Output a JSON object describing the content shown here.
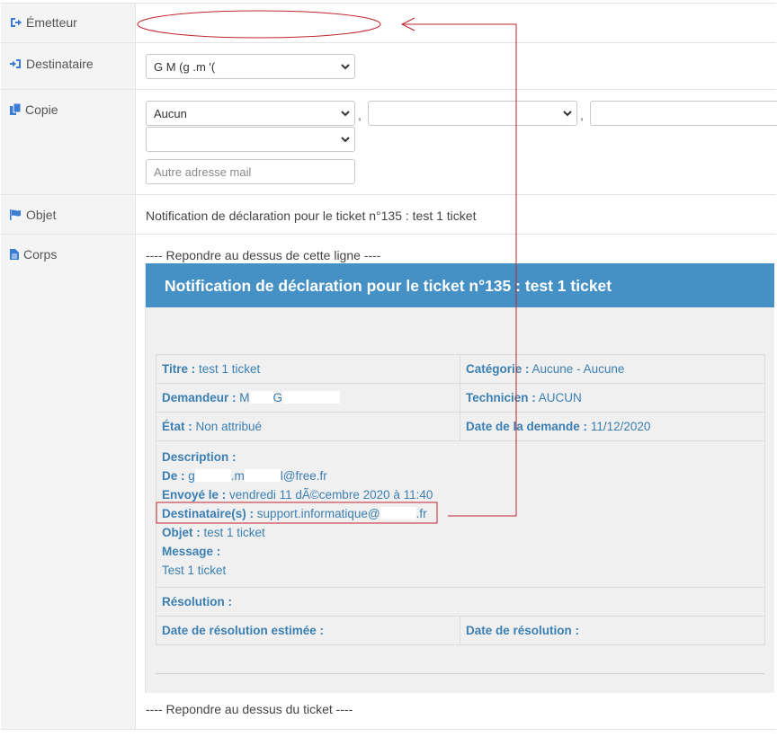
{
  "fields": {
    "emetteur": {
      "label": "Émetteur"
    },
    "destinataire": {
      "label": "Destinataire",
      "selected_value": "G          M      (g            .m          '("
    },
    "copie": {
      "label": "Copie",
      "select1_value": "Aucun",
      "separator": ",",
      "other_mail_placeholder": "Autre adresse mail"
    },
    "objet": {
      "label": "Objet",
      "value": "Notification de déclaration pour le ticket n°135 : test 1 ticket"
    },
    "corps": {
      "label": "Corps",
      "reply_above_line": "---- Repondre au dessus de cette ligne ----",
      "reply_above_ticket": "---- Repondre au dessus du ticket ----"
    }
  },
  "email": {
    "header": "Notification de déclaration pour le ticket n°135 : test 1 ticket",
    "titre": {
      "label": "Titre :",
      "value": "test 1 ticket"
    },
    "categorie": {
      "label": "Catégorie :",
      "value": "Aucune - Aucune"
    },
    "demandeur": {
      "label": "Demandeur :",
      "value_a": "M",
      "value_b": "G"
    },
    "technicien": {
      "label": "Technicien :",
      "value": "AUCUN"
    },
    "etat": {
      "label": "État :",
      "value": "Non attribué"
    },
    "date_demande": {
      "label": "Date de la demande :",
      "value": "11/12/2020"
    },
    "description": {
      "label": "Description :",
      "de_label": "De :",
      "de_a": "g",
      "de_b": ".m",
      "de_c": "l@free.fr",
      "envoye_label": "Envoyé le :",
      "envoye_value": "vendredi 11 dÃ©cembre 2020 à 11:40",
      "dest_label": "Destinataire(s) :",
      "dest_a": "support.informatique@",
      "dest_b": ".fr",
      "objet_label": "Objet :",
      "objet_value": "test 1 ticket",
      "message_label": "Message :",
      "message_value": "Test 1 ticket"
    },
    "resolution": {
      "label": "Résolution :"
    },
    "date_resolution_estimee": {
      "label": "Date de résolution estimée :"
    },
    "date_resolution": {
      "label": "Date de résolution :"
    }
  },
  "colors": {
    "header_blue": "#4590c5",
    "link_blue": "#3b7fb3",
    "annotation_red": "#c0242f"
  }
}
